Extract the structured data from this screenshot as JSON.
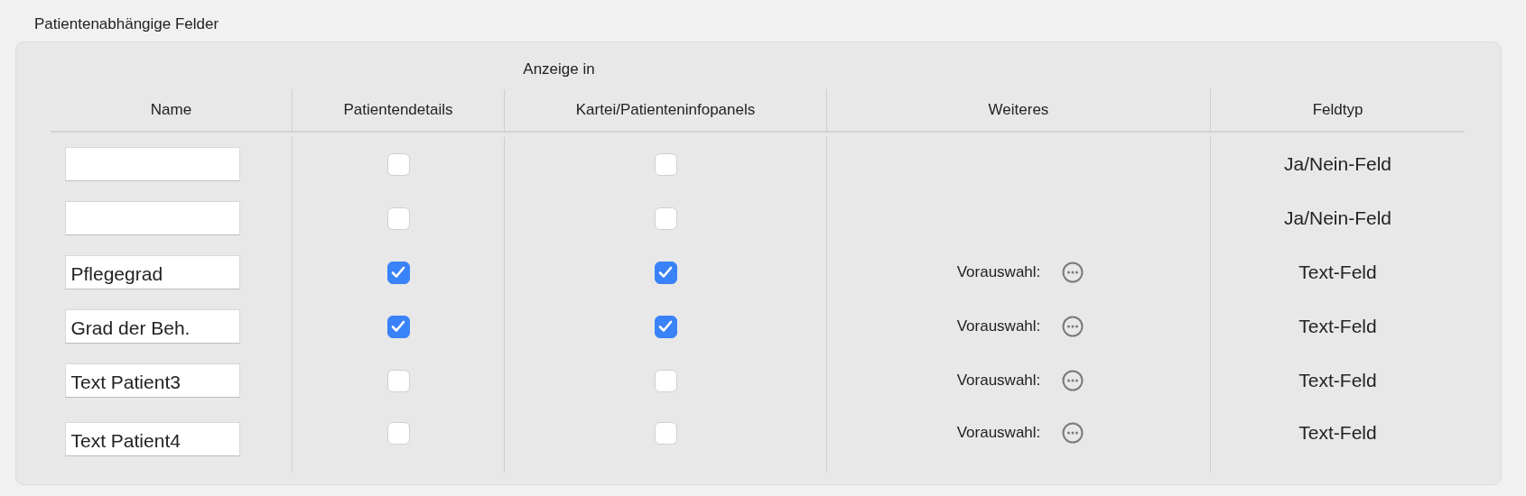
{
  "section_title": "Patientenabhängige Felder",
  "group_heading": "Anzeige in",
  "columns": [
    "Name",
    "Patientendetails",
    "Kartei/Patienteninfopanels",
    "Weiteres",
    "Feldtyp"
  ],
  "rows": [
    {
      "patient_details": false,
      "chart_panels": false,
      "field_type": "Ja/Nein-Feld"
    },
    {
      "patient_details": false,
      "chart_panels": false,
      "field_type": "Ja/Nein-Feld"
    },
    {
      "name": "Pflegegrad",
      "patient_details": true,
      "chart_panels": true,
      "preselection": "Vorauswahl:",
      "field_type": "Text-Feld"
    },
    {
      "name": "Grad der Beh.",
      "patient_details": true,
      "chart_panels": true,
      "preselection": "Vorauswahl:",
      "field_type": "Text-Feld"
    },
    {
      "name": "Text Patient3",
      "patient_details": false,
      "chart_panels": false,
      "preselection": "Vorauswahl:",
      "field_type": "Text-Feld"
    },
    {
      "name": "Text Patient4",
      "patient_details": false,
      "chart_panels": false,
      "preselection": "Vorauswahl:",
      "field_type": "Text-Feld"
    }
  ]
}
